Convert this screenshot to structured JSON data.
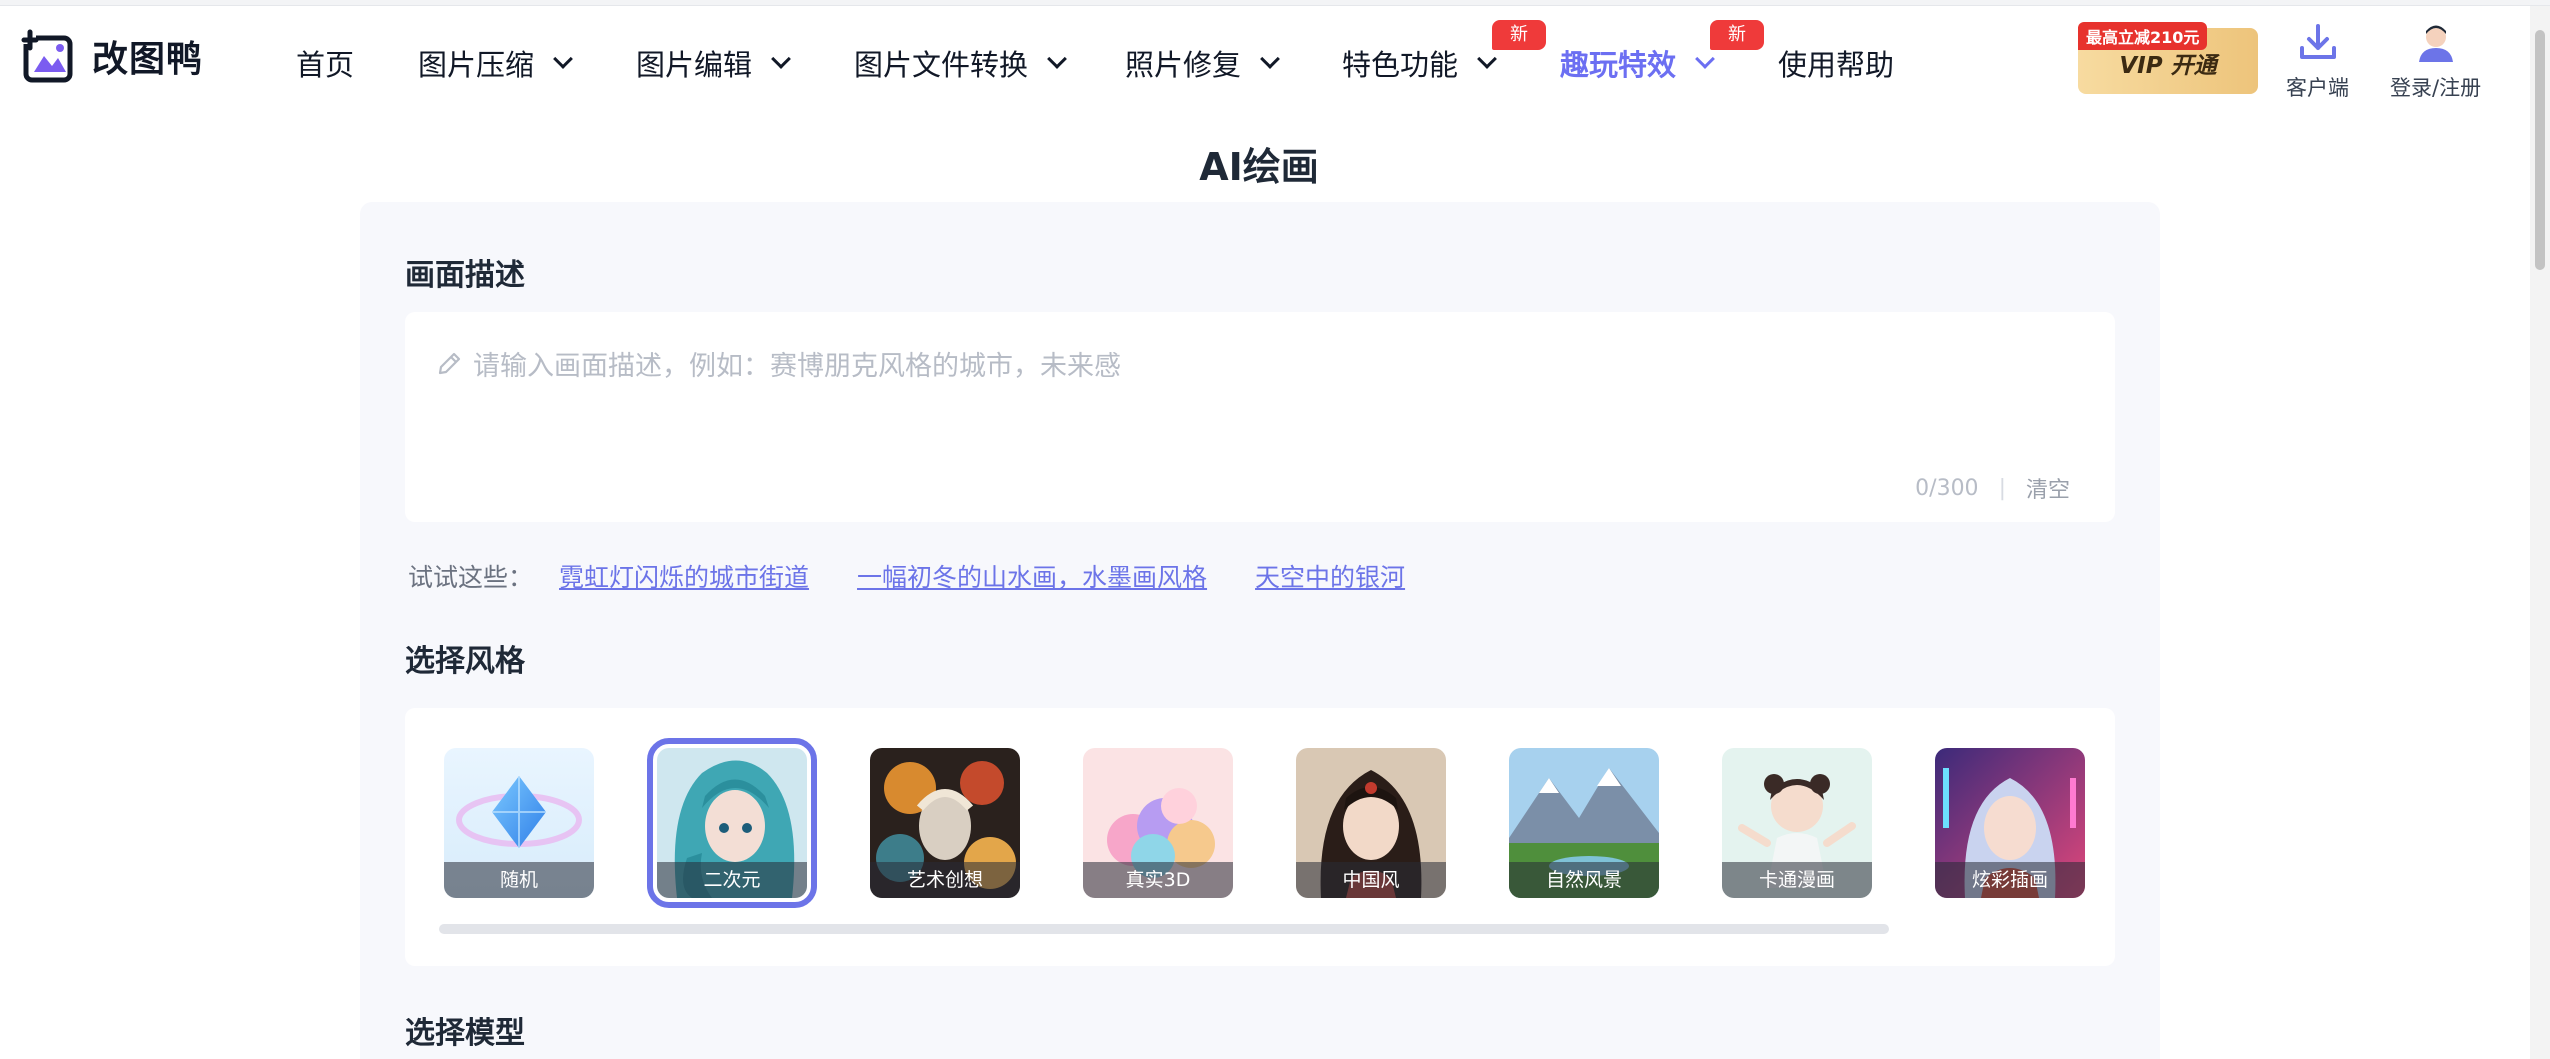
{
  "brand": {
    "name": "改图鸭"
  },
  "nav": {
    "items": [
      {
        "label": "首页",
        "has_dropdown": false
      },
      {
        "label": "图片压缩",
        "has_dropdown": true
      },
      {
        "label": "图片编辑",
        "has_dropdown": true
      },
      {
        "label": "图片文件转换",
        "has_dropdown": true
      },
      {
        "label": "照片修复",
        "has_dropdown": true
      },
      {
        "label": "特色功能",
        "has_dropdown": true,
        "badge": "新"
      },
      {
        "label": "趣玩特效",
        "has_dropdown": true,
        "badge": "新",
        "active": true
      },
      {
        "label": "使用帮助",
        "has_dropdown": false
      }
    ],
    "vip": {
      "tag": "最高立减210元",
      "label": "VIP 开通"
    },
    "client": {
      "label": "客户端",
      "icon": "download-icon"
    },
    "login": {
      "label": "登录/注册",
      "icon": "avatar-icon"
    }
  },
  "page": {
    "title": "AI绘画"
  },
  "prompt": {
    "section_title": "画面描述",
    "placeholder": "请输入画面描述，例如：赛博朋克风格的城市，未来感",
    "counter": "0/300",
    "separator": "|",
    "clear_label": "清空"
  },
  "suggestions": {
    "label": "试试这些：",
    "items": [
      "霓虹灯闪烁的城市街道",
      "一幅初冬的山水画，水墨画风格",
      "天空中的银河"
    ]
  },
  "styles": {
    "section_title": "选择风格",
    "selected_index": 1,
    "items": [
      {
        "label": "随机"
      },
      {
        "label": "二次元"
      },
      {
        "label": "艺术创想"
      },
      {
        "label": "真实3D"
      },
      {
        "label": "中国风"
      },
      {
        "label": "自然风景"
      },
      {
        "label": "卡通漫画"
      },
      {
        "label": "炫彩插画"
      }
    ]
  },
  "model": {
    "section_title": "选择模型"
  },
  "colors": {
    "accent": "#6c74e8",
    "badge": "#ef3a3a",
    "card_bg": "#f7f8fc"
  }
}
